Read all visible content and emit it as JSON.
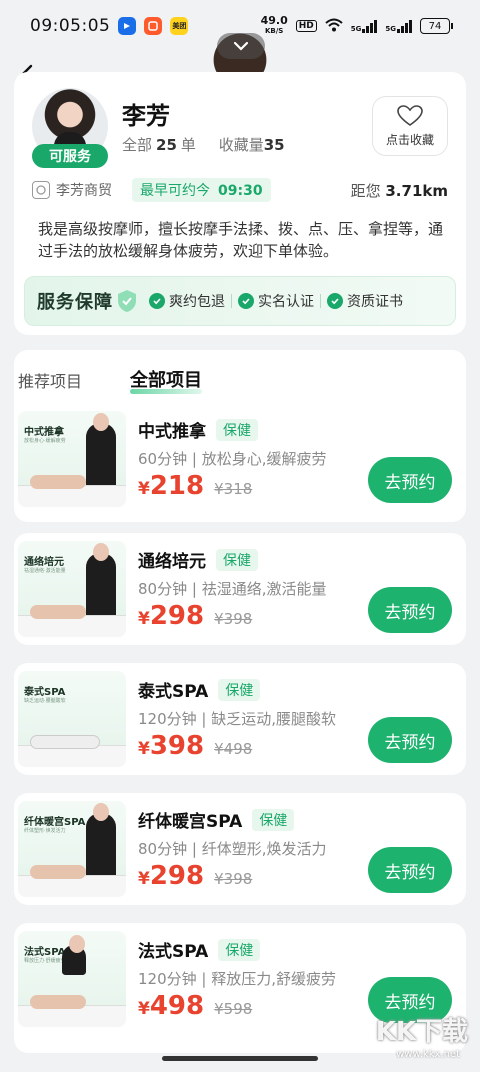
{
  "status_bar": {
    "time": "09:05:05",
    "speed_value": "49.0",
    "speed_unit": "KB/S",
    "hd": "HD",
    "net1": "5G",
    "net2": "5G",
    "battery": "74",
    "app_badge": "美团"
  },
  "profile": {
    "name": "李芳",
    "availability": "可服务",
    "all_orders_label": "全部",
    "all_orders_value": "25",
    "all_orders_unit": "单",
    "favorites_label": "收藏量",
    "favorites_value": "35",
    "fav_button_label": "点击收藏",
    "shop_name": "李芳商贸",
    "earliest_label": "最早可约今",
    "earliest_time": "09:30",
    "distance_label": "距您",
    "distance_value": "3.71km",
    "bio": "我是高级按摩师，擅长按摩手法揉、拨、点、压、拿捏等，通过手法的放松缓解身体疲劳，欢迎下单体验。"
  },
  "guarantee": {
    "title": "服务保障",
    "items": [
      "爽约包退",
      "实名认证",
      "资质证书"
    ]
  },
  "tabs": [
    {
      "label": "推荐项目"
    },
    {
      "label": "全部项目"
    }
  ],
  "book_label": "去预约",
  "items": [
    {
      "name": "中式推拿",
      "tag": "保健",
      "duration": "60分钟",
      "desc": "放松身心,缓解疲劳",
      "currency": "¥",
      "price": "218",
      "original": "¥318",
      "thumb_title": "中式推拿",
      "thumb_sub": "放松身心·缓解疲劳"
    },
    {
      "name": "通络培元",
      "tag": "保健",
      "duration": "80分钟",
      "desc": "祛湿通络,激活能量",
      "currency": "¥",
      "price": "298",
      "original": "¥398",
      "thumb_title": "通络培元",
      "thumb_sub": "祛湿通络·激活能量"
    },
    {
      "name": "泰式SPA",
      "tag": "保健",
      "duration": "120分钟",
      "desc": "缺乏运动,腰腿酸软",
      "currency": "¥",
      "price": "398",
      "original": "¥498",
      "thumb_title": "泰式SPA",
      "thumb_sub": "缺乏运动·腰腿酸软"
    },
    {
      "name": "纤体暖宫SPA",
      "tag": "保健",
      "duration": "80分钟",
      "desc": "纤体塑形,焕发活力",
      "currency": "¥",
      "price": "298",
      "original": "¥398",
      "thumb_title": "纤体暖宫SPA",
      "thumb_sub": "纤体塑形·焕发活力"
    },
    {
      "name": "法式SPA",
      "tag": "保健",
      "duration": "120分钟",
      "desc": "释放压力,舒缓疲劳",
      "currency": "¥",
      "price": "498",
      "original": "¥598",
      "thumb_title": "法式SPA",
      "thumb_sub": "释放压力·舒缓疲劳"
    }
  ],
  "watermark": {
    "text": "KK下载",
    "url": "www.kkx.net"
  },
  "colors": {
    "accent": "#1db26e",
    "price": "#e8432f",
    "tag_bg": "#e8f7ee"
  }
}
